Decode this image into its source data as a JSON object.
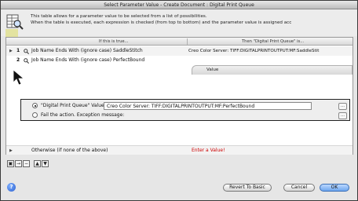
{
  "window": {
    "title": "Select Parameter Value - Create Document : Digital Print Queue"
  },
  "header": {
    "line1": "This table allows for a parameter value to be selected from a list of possibilities.",
    "line2": "When the table is executed, each expression is checked (from top to bottom) and the parameter value is assigned acc"
  },
  "table": {
    "columns": [
      "If this is true...",
      "Then \"Digital Print Queue\" is..."
    ],
    "rows": [
      {
        "num": "1",
        "expression": "Job Name Ends With (ignore case) SaddleStitch",
        "value": "Creo Color Server: TIFF:DIGITALPRINTOUTPUT:MF:SaddleStit"
      },
      {
        "num": "2",
        "expression": "Job Name Ends With (ignore case) PerfectBound",
        "value": ""
      }
    ],
    "value_tab": "Value",
    "option_set": {
      "set_label": "\"Digital Print Queue\" Value:",
      "set_value": "Creo Color Server: TIFF:DIGITALPRINTOUTPUT:MF:PerfectBound",
      "fail_label": "Fail the action.  Exception message:",
      "selected": "set"
    },
    "otherwise_label": "Otherwise (if none of the above)",
    "otherwise_value": "Enter a Value!"
  },
  "toolbar": {
    "icons": [
      "add-row-icon",
      "insert-row-icon",
      "delete-row-icon",
      "move-up-icon",
      "move-down-icon"
    ]
  },
  "buttons": {
    "help": "?",
    "revert": "Revert To Basic",
    "cancel": "Cancel",
    "ok": "OK"
  },
  "colors": {
    "error": "#cc0000",
    "highlight": "#e3e3a0"
  }
}
